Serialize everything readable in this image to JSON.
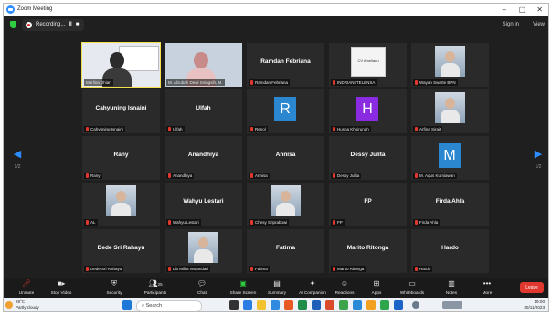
{
  "window": {
    "title": "Zoom Meeting",
    "minimize": "–",
    "maximize": "▢",
    "close": "✕"
  },
  "topbar": {
    "recording": "Recording...",
    "pause": "II",
    "stop": "■",
    "sign_in": "Sign in",
    "view": "View"
  },
  "nav": {
    "left_page": "1/2",
    "right_page": "1/2"
  },
  "participants": [
    {
      "label": "Marlina Dhian",
      "display": "",
      "type": "video",
      "muted": false
    },
    {
      "label": "M. Alzubah Dewi Sningsih, M.",
      "display": "",
      "type": "video",
      "muted": false
    },
    {
      "label": "Ramdan Febriana",
      "display": "Ramdan Febriana",
      "type": "name",
      "muted": true
    },
    {
      "label": "INDRIANI TELENSA",
      "display": "",
      "type": "logo",
      "logo_text": "CV Amelianu",
      "muted": true
    },
    {
      "label": "Wayan Swarte BPN",
      "display": "",
      "type": "photo",
      "muted": true
    },
    {
      "label": "Cahyuning Isnaini",
      "display": "Cahyuning Isnaini",
      "type": "name",
      "muted": true
    },
    {
      "label": "Ulfah",
      "display": "Ulfah",
      "type": "name",
      "muted": true
    },
    {
      "label": "Renol",
      "display": "",
      "type": "letter",
      "letter": "R",
      "color": "#2a87d0",
      "muted": true
    },
    {
      "label": "Husna Khoirunah",
      "display": "",
      "type": "letter",
      "letter": "H",
      "color": "#8a2be2",
      "muted": true
    },
    {
      "label": "Arfina Sirait",
      "display": "",
      "type": "photo",
      "muted": true
    },
    {
      "label": "Rany",
      "display": "Rany",
      "type": "name",
      "muted": true
    },
    {
      "label": "Anandhiya",
      "display": "Anandhiya",
      "type": "name",
      "muted": true
    },
    {
      "label": "Annisa",
      "display": "Annisa",
      "type": "name",
      "muted": true
    },
    {
      "label": "Dessy Julita",
      "display": "Dessy Julita",
      "type": "name",
      "muted": true
    },
    {
      "label": "M. Aqus Kurniawan",
      "display": "",
      "type": "letter",
      "letter": "M",
      "color": "#2a87d0",
      "muted": true
    },
    {
      "label": "AL",
      "display": "",
      "type": "photo",
      "muted": true
    },
    {
      "label": "Wahyu Lestari",
      "display": "Wahyu Lestari",
      "type": "name",
      "muted": true
    },
    {
      "label": "Chesy Sriprabowi",
      "display": "",
      "type": "photo",
      "muted": true
    },
    {
      "label": "FP",
      "display": "FP",
      "type": "name",
      "muted": true
    },
    {
      "label": "Firda Ahla",
      "display": "Firda Ahla",
      "type": "name",
      "muted": true
    },
    {
      "label": "Dede Sri Rahayu",
      "display": "Dede Sri Rahayu",
      "type": "name",
      "muted": true
    },
    {
      "label": "Lib Millia Wulandari",
      "display": "",
      "type": "photo",
      "muted": true
    },
    {
      "label": "Fatima",
      "display": "Fatima",
      "type": "name",
      "muted": true
    },
    {
      "label": "Marito Ritonga",
      "display": "Marito Ritonga",
      "type": "name",
      "muted": true
    },
    {
      "label": "Hardo",
      "display": "Hardo",
      "type": "name",
      "muted": true
    }
  ],
  "toolbar": {
    "unmute": "Unmute",
    "stop_video": "Stop Video",
    "security": "Security",
    "participants": "Participants",
    "participants_count": "25",
    "chat": "Chat",
    "share_screen": "Share Screen",
    "summary": "Summary",
    "ai_companion": "AI Companion",
    "reactions": "Reactions",
    "apps": "Apps",
    "whiteboards": "Whiteboards",
    "notes": "Notes",
    "more": "More",
    "leave": "Leave"
  },
  "taskbar": {
    "weather_temp": "28°C",
    "weather_desc": "Partly cloudy",
    "search": "Search",
    "time": "19:00",
    "date": "30/11/2023"
  },
  "colors": {
    "accent": "#2d8cff",
    "leave": "#e0382f",
    "share": "#2ecc40"
  }
}
